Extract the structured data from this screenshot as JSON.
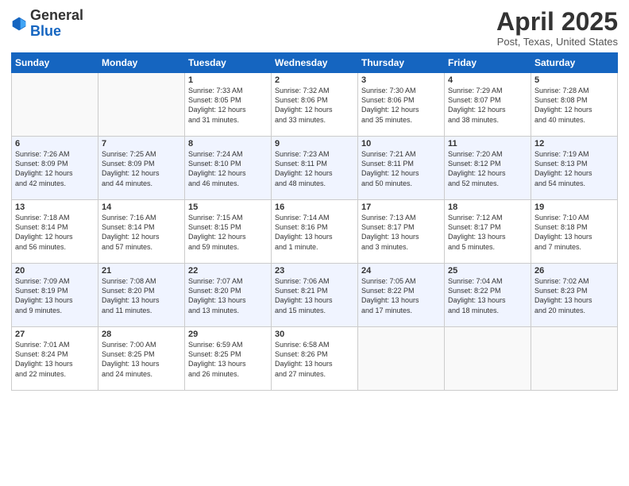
{
  "header": {
    "logo_general": "General",
    "logo_blue": "Blue",
    "month_title": "April 2025",
    "location": "Post, Texas, United States"
  },
  "days_of_week": [
    "Sunday",
    "Monday",
    "Tuesday",
    "Wednesday",
    "Thursday",
    "Friday",
    "Saturday"
  ],
  "weeks": [
    [
      {
        "day": "",
        "info": ""
      },
      {
        "day": "",
        "info": ""
      },
      {
        "day": "1",
        "info": "Sunrise: 7:33 AM\nSunset: 8:05 PM\nDaylight: 12 hours\nand 31 minutes."
      },
      {
        "day": "2",
        "info": "Sunrise: 7:32 AM\nSunset: 8:06 PM\nDaylight: 12 hours\nand 33 minutes."
      },
      {
        "day": "3",
        "info": "Sunrise: 7:30 AM\nSunset: 8:06 PM\nDaylight: 12 hours\nand 35 minutes."
      },
      {
        "day": "4",
        "info": "Sunrise: 7:29 AM\nSunset: 8:07 PM\nDaylight: 12 hours\nand 38 minutes."
      },
      {
        "day": "5",
        "info": "Sunrise: 7:28 AM\nSunset: 8:08 PM\nDaylight: 12 hours\nand 40 minutes."
      }
    ],
    [
      {
        "day": "6",
        "info": "Sunrise: 7:26 AM\nSunset: 8:09 PM\nDaylight: 12 hours\nand 42 minutes."
      },
      {
        "day": "7",
        "info": "Sunrise: 7:25 AM\nSunset: 8:09 PM\nDaylight: 12 hours\nand 44 minutes."
      },
      {
        "day": "8",
        "info": "Sunrise: 7:24 AM\nSunset: 8:10 PM\nDaylight: 12 hours\nand 46 minutes."
      },
      {
        "day": "9",
        "info": "Sunrise: 7:23 AM\nSunset: 8:11 PM\nDaylight: 12 hours\nand 48 minutes."
      },
      {
        "day": "10",
        "info": "Sunrise: 7:21 AM\nSunset: 8:11 PM\nDaylight: 12 hours\nand 50 minutes."
      },
      {
        "day": "11",
        "info": "Sunrise: 7:20 AM\nSunset: 8:12 PM\nDaylight: 12 hours\nand 52 minutes."
      },
      {
        "day": "12",
        "info": "Sunrise: 7:19 AM\nSunset: 8:13 PM\nDaylight: 12 hours\nand 54 minutes."
      }
    ],
    [
      {
        "day": "13",
        "info": "Sunrise: 7:18 AM\nSunset: 8:14 PM\nDaylight: 12 hours\nand 56 minutes."
      },
      {
        "day": "14",
        "info": "Sunrise: 7:16 AM\nSunset: 8:14 PM\nDaylight: 12 hours\nand 57 minutes."
      },
      {
        "day": "15",
        "info": "Sunrise: 7:15 AM\nSunset: 8:15 PM\nDaylight: 12 hours\nand 59 minutes."
      },
      {
        "day": "16",
        "info": "Sunrise: 7:14 AM\nSunset: 8:16 PM\nDaylight: 13 hours\nand 1 minute."
      },
      {
        "day": "17",
        "info": "Sunrise: 7:13 AM\nSunset: 8:17 PM\nDaylight: 13 hours\nand 3 minutes."
      },
      {
        "day": "18",
        "info": "Sunrise: 7:12 AM\nSunset: 8:17 PM\nDaylight: 13 hours\nand 5 minutes."
      },
      {
        "day": "19",
        "info": "Sunrise: 7:10 AM\nSunset: 8:18 PM\nDaylight: 13 hours\nand 7 minutes."
      }
    ],
    [
      {
        "day": "20",
        "info": "Sunrise: 7:09 AM\nSunset: 8:19 PM\nDaylight: 13 hours\nand 9 minutes."
      },
      {
        "day": "21",
        "info": "Sunrise: 7:08 AM\nSunset: 8:20 PM\nDaylight: 13 hours\nand 11 minutes."
      },
      {
        "day": "22",
        "info": "Sunrise: 7:07 AM\nSunset: 8:20 PM\nDaylight: 13 hours\nand 13 minutes."
      },
      {
        "day": "23",
        "info": "Sunrise: 7:06 AM\nSunset: 8:21 PM\nDaylight: 13 hours\nand 15 minutes."
      },
      {
        "day": "24",
        "info": "Sunrise: 7:05 AM\nSunset: 8:22 PM\nDaylight: 13 hours\nand 17 minutes."
      },
      {
        "day": "25",
        "info": "Sunrise: 7:04 AM\nSunset: 8:22 PM\nDaylight: 13 hours\nand 18 minutes."
      },
      {
        "day": "26",
        "info": "Sunrise: 7:02 AM\nSunset: 8:23 PM\nDaylight: 13 hours\nand 20 minutes."
      }
    ],
    [
      {
        "day": "27",
        "info": "Sunrise: 7:01 AM\nSunset: 8:24 PM\nDaylight: 13 hours\nand 22 minutes."
      },
      {
        "day": "28",
        "info": "Sunrise: 7:00 AM\nSunset: 8:25 PM\nDaylight: 13 hours\nand 24 minutes."
      },
      {
        "day": "29",
        "info": "Sunrise: 6:59 AM\nSunset: 8:25 PM\nDaylight: 13 hours\nand 26 minutes."
      },
      {
        "day": "30",
        "info": "Sunrise: 6:58 AM\nSunset: 8:26 PM\nDaylight: 13 hours\nand 27 minutes."
      },
      {
        "day": "",
        "info": ""
      },
      {
        "day": "",
        "info": ""
      },
      {
        "day": "",
        "info": ""
      }
    ]
  ]
}
